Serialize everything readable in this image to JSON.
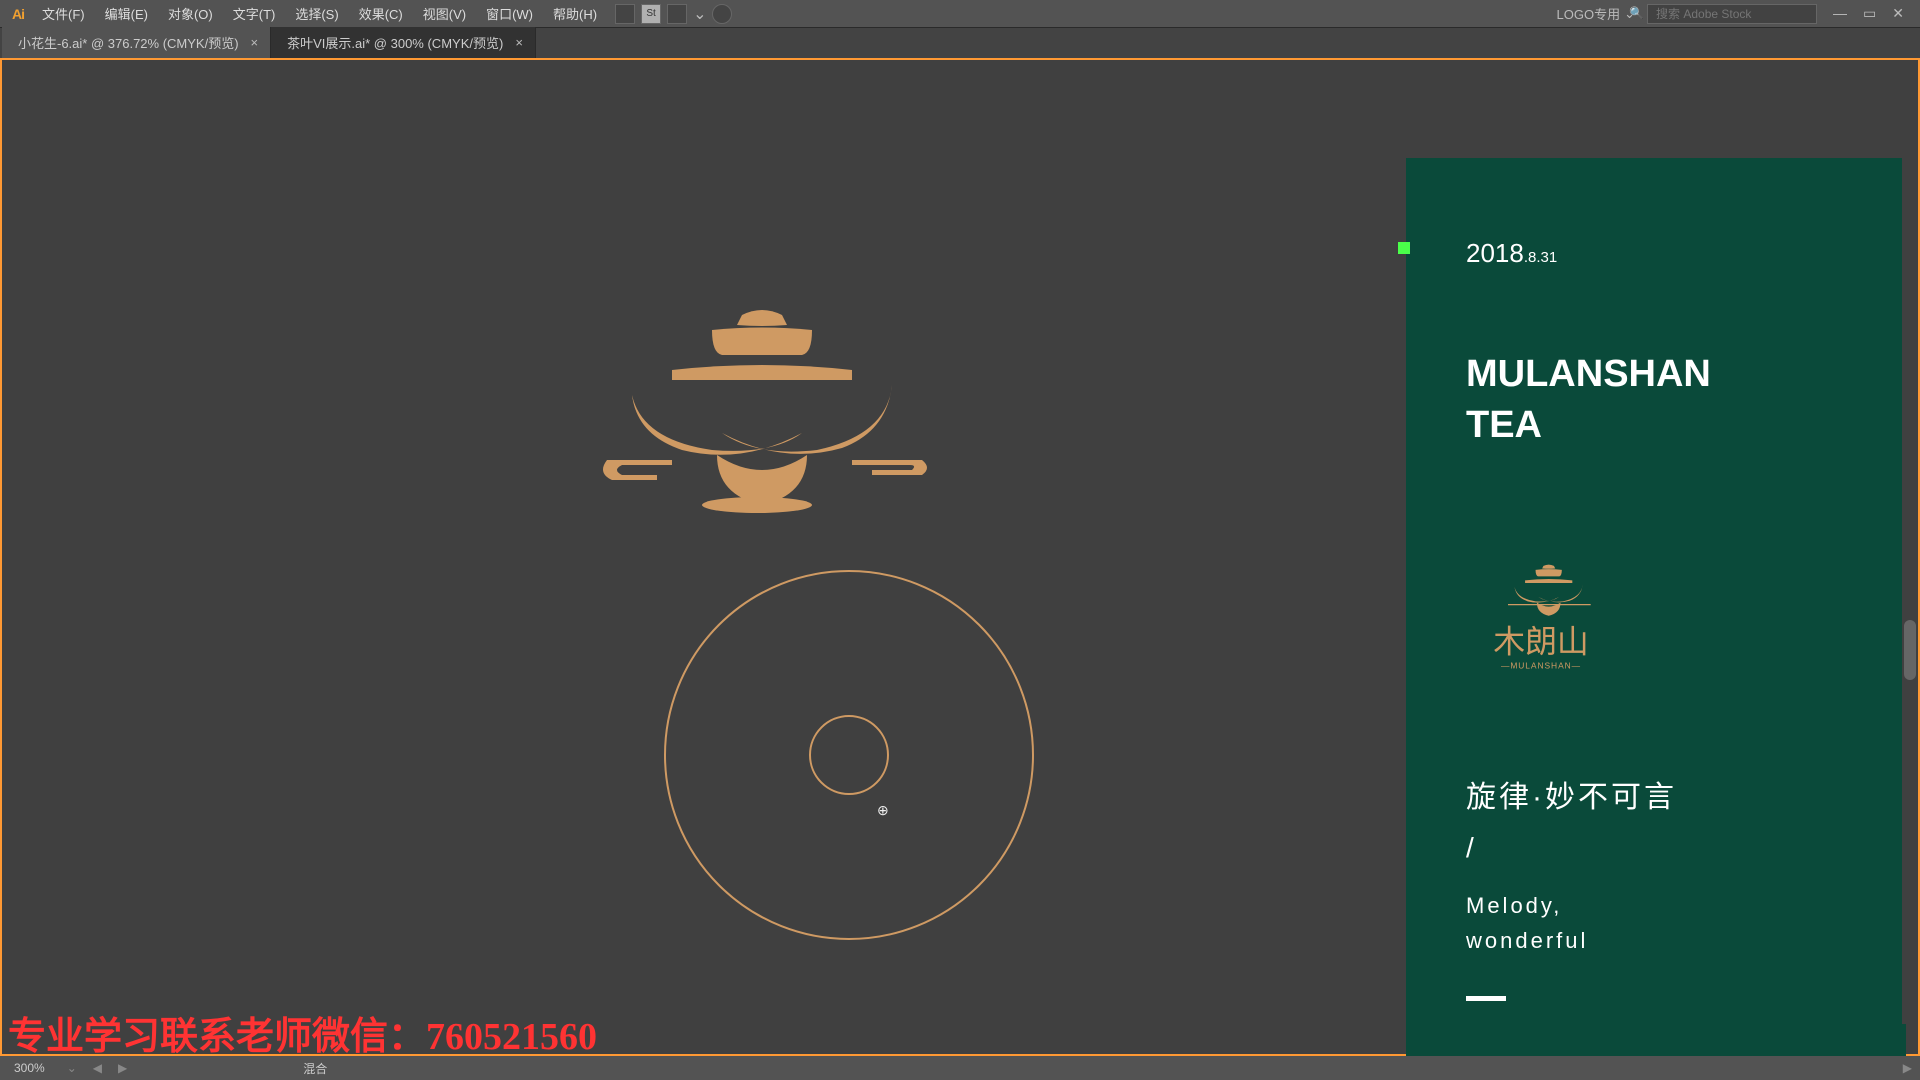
{
  "app": {
    "logo": "Ai"
  },
  "menu": {
    "file": "文件(F)",
    "edit": "编辑(E)",
    "object": "对象(O)",
    "type": "文字(T)",
    "select": "选择(S)",
    "effect": "效果(C)",
    "view": "视图(V)",
    "window": "窗口(W)",
    "help": "帮助(H)"
  },
  "workspace": {
    "label": "LOGO专用",
    "chevron": "⌄"
  },
  "search": {
    "placeholder": "搜索 Adobe Stock",
    "icon": "🔍"
  },
  "tabs": {
    "tab1": "小花生-6.ai* @ 376.72% (CMYK/预览)",
    "tab2": "茶叶VI展示.ai* @ 300% (CMYK/预览)"
  },
  "promo": {
    "date_big": "2018",
    "date_small": ".8.31",
    "brand_line1": "MULANSHAN",
    "brand_line2": "TEA",
    "cn_name": "木朗山",
    "cn_sub": "MULANSHAN",
    "cn_slogan": "旋律·妙不可言",
    "slash": "/",
    "en_slogan_1": "Melody,",
    "en_slogan_2": "wonderful"
  },
  "status": {
    "zoom": "300%",
    "tool_hint": "混合"
  },
  "watermark": "专业学习联系老师微信：760521560",
  "colors": {
    "brand_tan": "#cf9a63",
    "promo_green": "#0a4a3a",
    "highlight_orange": "#ff9933"
  }
}
